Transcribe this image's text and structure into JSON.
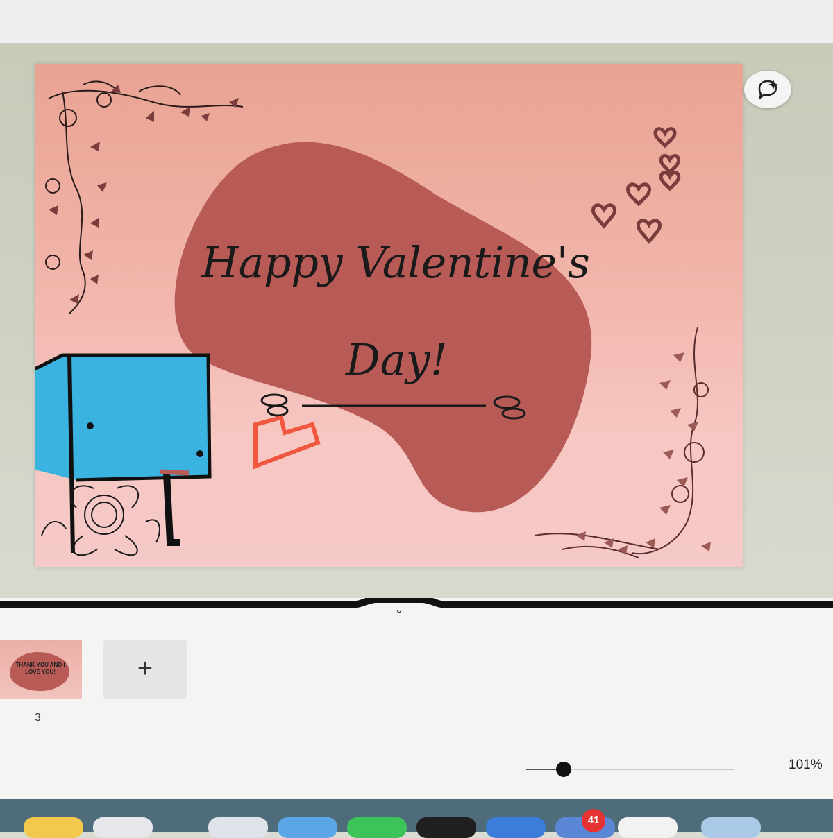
{
  "design": {
    "heading_line1": "Happy Valentine's",
    "heading_line2": "Day!",
    "colors": {
      "background_top": "#e9a393",
      "background_bottom": "#f5c9c7",
      "blob": "#b85b57",
      "ink": "#1a1a1a",
      "floral": "#7a3c3c",
      "blue_sketch": "#3bb3e0",
      "red_sketch": "#f0573e"
    }
  },
  "toolbar": {
    "magic_button_icon": "sparkle-comment-icon"
  },
  "pages": {
    "collapse_icon": "chevron-down-icon",
    "thumbnail_text": "THANK YOU AND I LOVE YOU!",
    "page_number": "3",
    "add_label": "+"
  },
  "zoom": {
    "level": "101%",
    "value": 0.18
  },
  "dock": {
    "badge_count": "41",
    "icons": [
      "notes-icon",
      "safari-icon",
      "pages-icon",
      "files-icon",
      "whatsapp-icon",
      "music-icon",
      "app-icon",
      "calendar-icon",
      "freeform-icon",
      "finder-icon"
    ]
  }
}
